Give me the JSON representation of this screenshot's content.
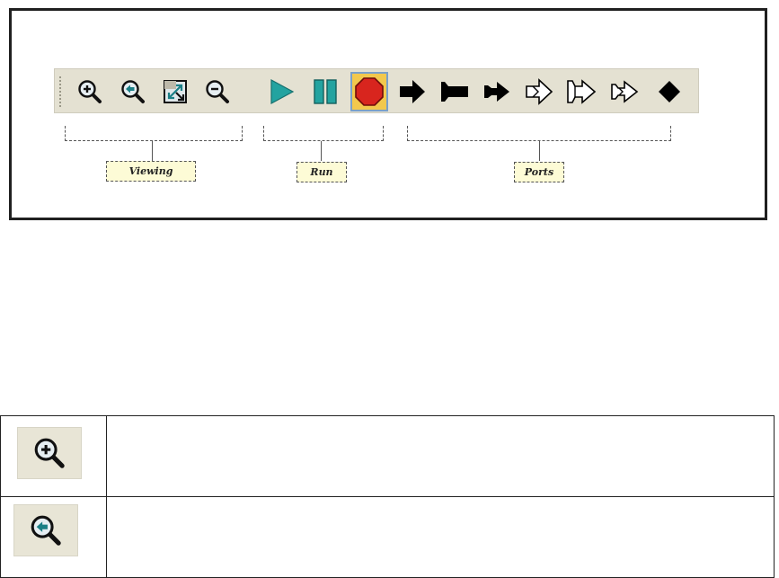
{
  "toolbar": {
    "groups": [
      {
        "id": "viewing",
        "label": "Viewing",
        "buttons": [
          "zoom-in",
          "zoom-reset",
          "zoom-to-fit",
          "zoom-out"
        ]
      },
      {
        "id": "run",
        "label": "Run",
        "buttons": [
          "run",
          "pause",
          "stop"
        ]
      },
      {
        "id": "ports",
        "label": "Ports",
        "buttons": [
          "input-port",
          "output-port",
          "io-port",
          "multi-input-port",
          "multi-output-port",
          "multi-io-port",
          "relation"
        ]
      }
    ],
    "active_button": "stop"
  },
  "reference_table": {
    "rows": [
      {
        "icon": "zoom-in-icon",
        "description": ""
      },
      {
        "icon": "zoom-reset-icon",
        "description": ""
      }
    ]
  },
  "colors": {
    "toolbar_bg": "#e4e1d2",
    "run_teal": "#23a3a0",
    "stop_red": "#d8251e",
    "stop_bg": "#f2c84d",
    "label_bg": "#fdfbd6"
  }
}
